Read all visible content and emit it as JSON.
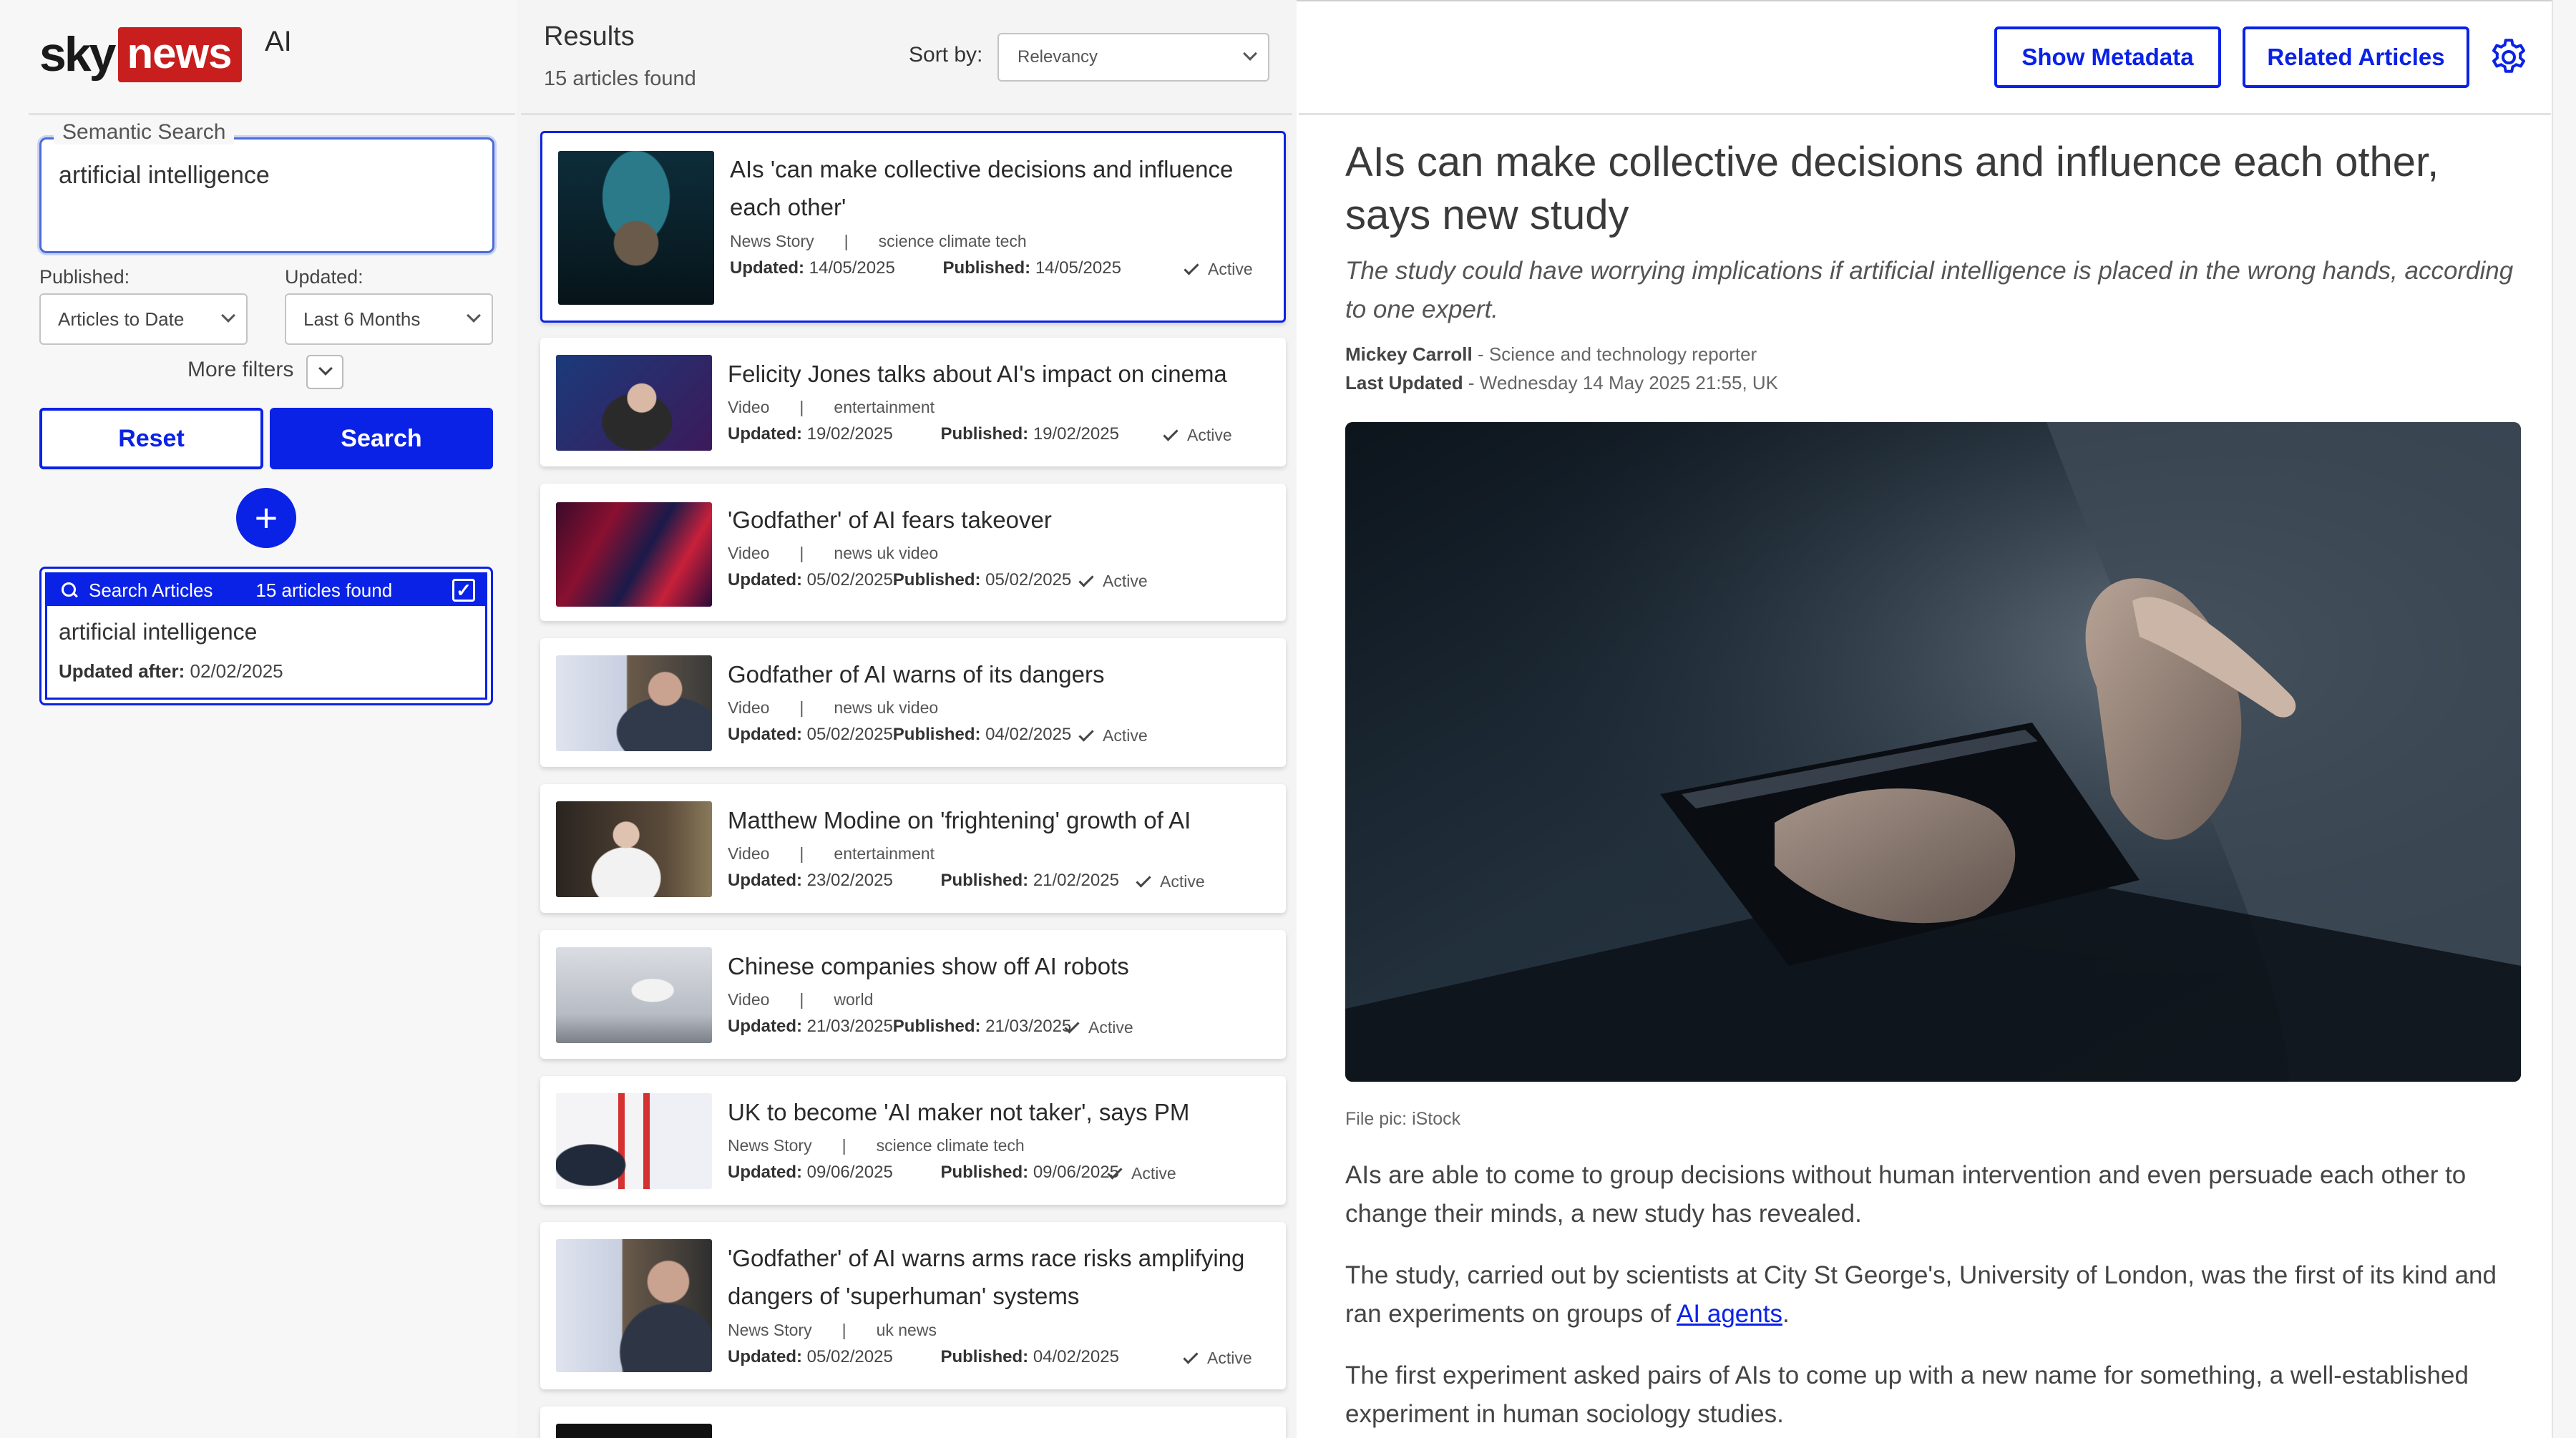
{
  "brand": {
    "sky": "sky",
    "news": "news",
    "ai": "AI",
    "news_red": "#c81e1e",
    "accent": "#0a22e6"
  },
  "search": {
    "legend": "Semantic Search",
    "query": "artificial intelligence",
    "published_label": "Published:",
    "published_value": "Articles to Date",
    "updated_label": "Updated:",
    "updated_value": "Last 6 Months",
    "more_filters": "More filters",
    "reset": "Reset",
    "search": "Search",
    "add_icon": "plus-icon"
  },
  "saved_search": {
    "label": "Search Articles",
    "count": "15 articles found",
    "query": "artificial intelligence",
    "updated_after_label": "Updated after:",
    "updated_after_value": "02/02/2025",
    "checked": true
  },
  "results": {
    "title": "Results",
    "count": "15 articles found",
    "sort_label": "Sort by:",
    "sort_value": "Relevancy",
    "updated_label": "Updated:",
    "published_label": "Published:",
    "items": [
      {
        "title": "AIs 'can make collective decisions and influence each other'",
        "type": "News Story",
        "category": "science climate tech",
        "updated": "14/05/2025",
        "published": "14/05/2025",
        "status": "Active"
      },
      {
        "title": "Felicity Jones talks about AI's impact on cinema",
        "type": "Video",
        "category": "entertainment",
        "updated": "19/02/2025",
        "published": "19/02/2025",
        "status": "Active"
      },
      {
        "title": "'Godfather' of AI fears takeover",
        "type": "Video",
        "category": "news uk video",
        "updated": "05/02/2025",
        "published": "05/02/2025",
        "status": "Active"
      },
      {
        "title": "Godfather of AI warns of its dangers",
        "type": "Video",
        "category": "news uk video",
        "updated": "05/02/2025",
        "published": "04/02/2025",
        "status": "Active"
      },
      {
        "title": "Matthew Modine on 'frightening' growth of AI",
        "type": "Video",
        "category": "entertainment",
        "updated": "23/02/2025",
        "published": "21/02/2025",
        "status": "Active"
      },
      {
        "title": "Chinese companies show off AI robots",
        "type": "Video",
        "category": "world",
        "updated": "21/03/2025",
        "published": "21/03/2025",
        "status": "Active"
      },
      {
        "title": "UK to become 'AI maker not taker', says PM",
        "type": "News Story",
        "category": "science climate tech",
        "updated": "09/06/2025",
        "published": "09/06/2025",
        "status": "Active"
      },
      {
        "title": "'Godfather' of AI warns arms race risks amplifying dangers of 'superhuman' systems",
        "type": "News Story",
        "category": "uk news",
        "updated": "05/02/2025",
        "published": "04/02/2025",
        "status": "Active"
      }
    ]
  },
  "toolbar": {
    "show_metadata": "Show Metadata",
    "related_articles": "Related Articles",
    "settings_icon": "gear-icon"
  },
  "article": {
    "title": "AIs can make collective decisions and influence each other, says new study",
    "subtitle": "The study could have worrying implications if artificial intelligence is placed in the wrong hands, according to one expert.",
    "author": "Mickey Carroll",
    "author_role": " - Science and technology reporter",
    "updated_label": "Last Updated",
    "updated_value": " - Wednesday 14 May 2025 21:55, UK",
    "caption": "File pic: iStock",
    "p1": "AIs are able to come to group decisions without human intervention and even persuade each other to change their minds, a new study has revealed.",
    "p2_before": "The study, carried out by scientists at City St George's, University of London, was the first of its kind and ran experiments on groups of ",
    "p2_link": "AI agents",
    "p2_after": ".",
    "p3": "The first experiment asked pairs of AIs to come up with a new name for something, a well-established experiment in human sociology studies."
  }
}
